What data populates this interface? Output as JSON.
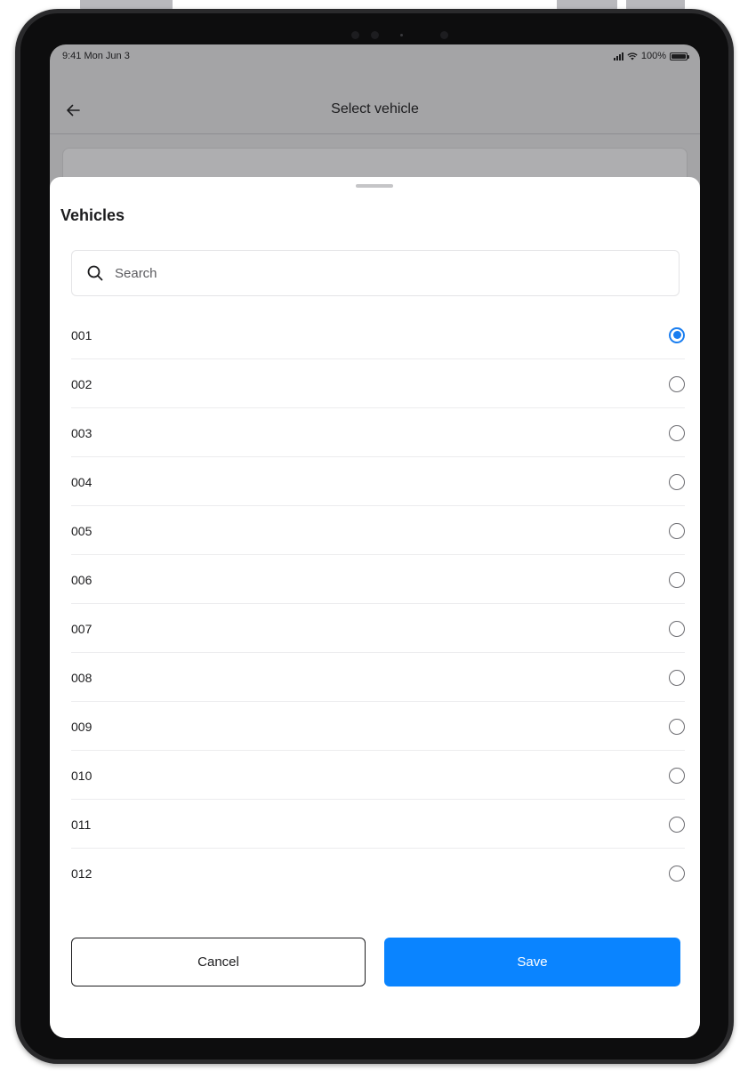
{
  "status_bar": {
    "time_date": "9:41 Mon Jun 3",
    "battery": "100%"
  },
  "nav": {
    "title": "Select vehicle",
    "back_icon": "arrow-left-icon"
  },
  "sheet": {
    "title": "Vehicles",
    "search": {
      "placeholder": "Search",
      "value": "",
      "icon": "search-icon"
    },
    "vehicles": [
      {
        "label": "001",
        "selected": true
      },
      {
        "label": "002",
        "selected": false
      },
      {
        "label": "003",
        "selected": false
      },
      {
        "label": "004",
        "selected": false
      },
      {
        "label": "005",
        "selected": false
      },
      {
        "label": "006",
        "selected": false
      },
      {
        "label": "007",
        "selected": false
      },
      {
        "label": "008",
        "selected": false
      },
      {
        "label": "009",
        "selected": false
      },
      {
        "label": "010",
        "selected": false
      },
      {
        "label": "011",
        "selected": false
      },
      {
        "label": "012",
        "selected": false
      }
    ],
    "cancel_label": "Cancel",
    "save_label": "Save"
  },
  "colors": {
    "accent": "#0a84ff",
    "radio_selected": "#1a7ef0",
    "overlay": "#a4a4a6"
  }
}
